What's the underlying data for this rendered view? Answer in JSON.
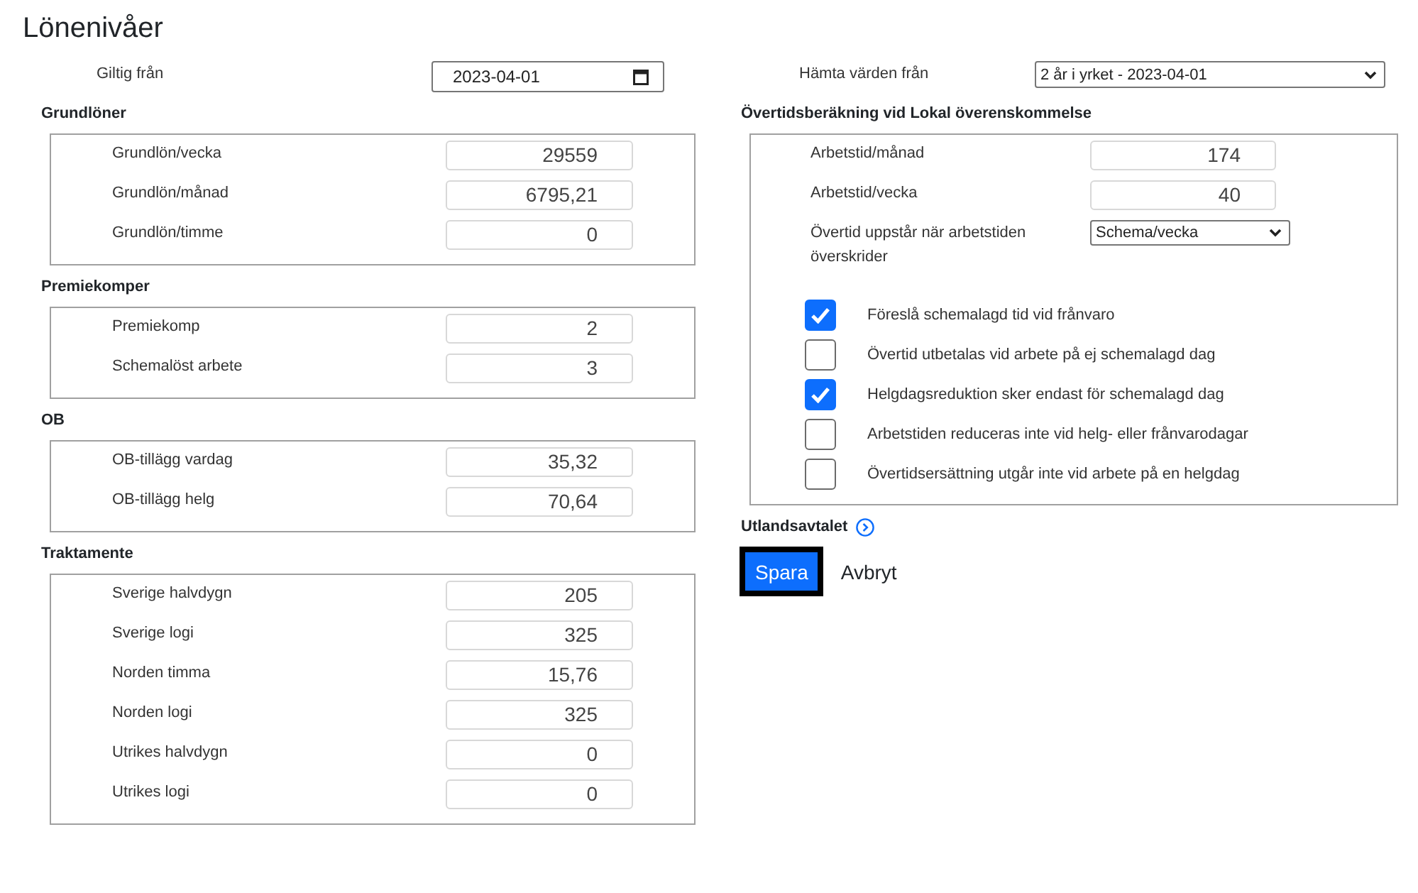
{
  "page": {
    "title": "Lönenivåer"
  },
  "valid_from": {
    "label": "Giltig från",
    "value": "2023-04-01"
  },
  "fetch_values": {
    "label": "Hämta värden från",
    "value": "2 år i yrket - 2023-04-01"
  },
  "sections": [
    {
      "heading": "Grundlöner",
      "fields": [
        {
          "label": "Grundlön/vecka",
          "value": "29559"
        },
        {
          "label": "Grundlön/månad",
          "value": "6795,21"
        },
        {
          "label": "Grundlön/timme",
          "value": "0"
        }
      ]
    },
    {
      "heading": "Premiekomper",
      "fields": [
        {
          "label": "Premiekomp",
          "value": "2"
        },
        {
          "label": "Schemalöst arbete",
          "value": "3"
        }
      ]
    },
    {
      "heading": "OB",
      "fields": [
        {
          "label": "OB-tillägg vardag",
          "value": "35,32"
        },
        {
          "label": "OB-tillägg helg",
          "value": "70,64"
        }
      ]
    },
    {
      "heading": "Traktamente",
      "fields": [
        {
          "label": "Sverige halvdygn",
          "value": "205"
        },
        {
          "label": "Sverige logi",
          "value": "325"
        },
        {
          "label": "Norden timma",
          "value": "15,76"
        },
        {
          "label": "Norden logi",
          "value": "325"
        },
        {
          "label": "Utrikes halvdygn",
          "value": "0"
        },
        {
          "label": "Utrikes logi",
          "value": "0"
        }
      ]
    }
  ],
  "overtime": {
    "heading": "Övertidsberäkning vid Lokal överenskommelse",
    "fields": [
      {
        "kind": "number",
        "label": "Arbetstid/månad",
        "value": "174"
      },
      {
        "kind": "number",
        "label": "Arbetstid/vecka",
        "value": "40"
      },
      {
        "kind": "select",
        "label": "Övertid uppstår när arbetstiden överskrider",
        "value": "Schema/vecka"
      }
    ],
    "options": [
      {
        "label": "Föreslå schemalagd tid vid frånvaro",
        "checked": true
      },
      {
        "label": "Övertid utbetalas vid arbete på ej schemalagd dag",
        "checked": false
      },
      {
        "label": "Helgdagsreduktion sker endast för schemalagd dag",
        "checked": true
      },
      {
        "label": "Arbetstiden reduceras inte vid helg- eller frånvarodagar",
        "checked": false
      },
      {
        "label": "Övertidsersättning utgår inte vid arbete på en helgdag",
        "checked": false
      }
    ]
  },
  "foreign_agreement": {
    "label": "Utlandsavtalet"
  },
  "buttons": [
    {
      "kind": "primary",
      "label": "Spara",
      "focused": true
    },
    {
      "kind": "link",
      "label": "Avbryt",
      "focused": false
    }
  ]
}
